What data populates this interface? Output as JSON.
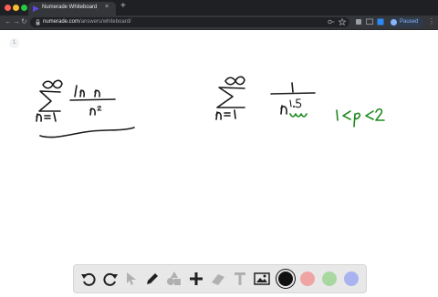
{
  "browser": {
    "tab_title": "Numerade Whiteboard",
    "tab_close": "×",
    "new_tab": "+",
    "url_host": "numerade.com",
    "url_path": "/answers/whiteboard/",
    "profile_status": "Paused",
    "menu_glyph": "⋮",
    "nav_back": "←",
    "nav_forward": "→",
    "nav_reload": "↻"
  },
  "whiteboard": {
    "page_number": "1",
    "handwriting": {
      "series_1": {
        "upper_limit": "∞",
        "sum_symbol": "∑",
        "numerator": "ln n",
        "denominator": "n²",
        "index": "n=1"
      },
      "series_2": {
        "upper_limit": "∞",
        "sum_symbol": "∑",
        "numerator": "1",
        "denominator_base": "n",
        "exponent": "1.5",
        "index": "n=1"
      },
      "condition": "1<p<2"
    },
    "ink_colors": {
      "dark": "#1a1a1a",
      "green": "#1f8a1f"
    }
  },
  "tools": {
    "colors": {
      "black": "#111111",
      "red": "#f0a3a3",
      "green": "#a8d8a0",
      "blue": "#a9b3f0"
    }
  }
}
